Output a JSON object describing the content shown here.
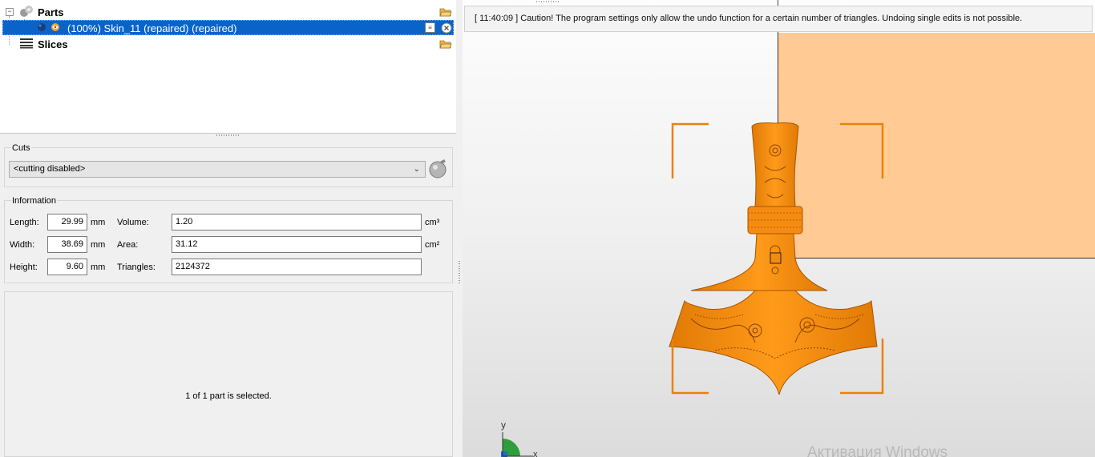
{
  "tree": {
    "parts_label": "Parts",
    "part_item": "(100%) Skin_11 (repaired) (repaired)",
    "slices_label": "Slices"
  },
  "cuts": {
    "title": "Cuts",
    "selected": "<cutting disabled>"
  },
  "information": {
    "title": "Information",
    "length_label": "Length:",
    "length_value": "29.99",
    "width_label": "Width:",
    "width_value": "38.69",
    "height_label": "Height:",
    "height_value": "9.60",
    "unit_mm": "mm",
    "volume_label": "Volume:",
    "volume_value": "1.20",
    "area_label": "Area:",
    "area_value": "31.12",
    "triangles_label": "Triangles:",
    "triangles_value": "2124372",
    "unit_cm3": "cm³",
    "unit_cm2": "cm²"
  },
  "status": "1 of 1 part is selected.",
  "viewport": {
    "log_message": "[ 11:40:09 ] Caution! The program settings only allow the undo function for a certain number of triangles. Undoing single edits is not possible.",
    "axis_y": "y",
    "axis_x": "x",
    "watermark": "Активация Windows"
  },
  "colors": {
    "selection": "#0a64c8",
    "model": "#f28c0f",
    "plane": "#ffca94",
    "bbox": "#e8820c"
  }
}
